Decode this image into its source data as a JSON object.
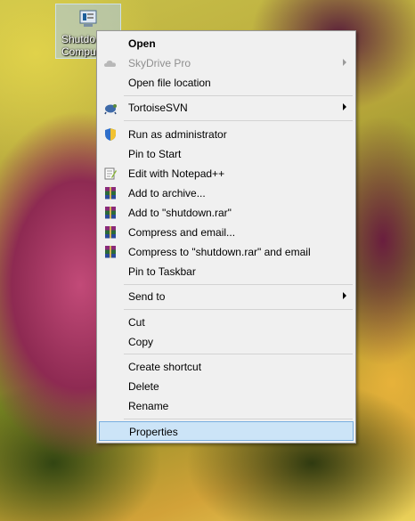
{
  "desktop": {
    "icon_caption": "Shutdo\nCompu"
  },
  "menu": {
    "items": [
      {
        "label": "Open"
      },
      {
        "label": "SkyDrive Pro"
      },
      {
        "label": "Open file location"
      },
      {
        "label": "TortoiseSVN"
      },
      {
        "label": "Run as administrator"
      },
      {
        "label": "Pin to Start"
      },
      {
        "label": "Edit with Notepad++"
      },
      {
        "label": "Add to archive..."
      },
      {
        "label": "Add to \"shutdown.rar\""
      },
      {
        "label": "Compress and email..."
      },
      {
        "label": "Compress to \"shutdown.rar\" and email"
      },
      {
        "label": "Pin to Taskbar"
      },
      {
        "label": "Send to"
      },
      {
        "label": "Cut"
      },
      {
        "label": "Copy"
      },
      {
        "label": "Create shortcut"
      },
      {
        "label": "Delete"
      },
      {
        "label": "Rename"
      },
      {
        "label": "Properties"
      }
    ]
  }
}
